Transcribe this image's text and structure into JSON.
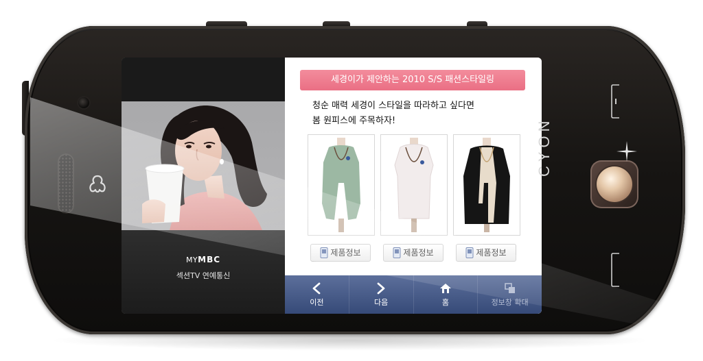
{
  "device": {
    "brand_text": "CYON"
  },
  "left_pane": {
    "caption_logo_prefix": "MY",
    "caption_logo_suffix": "MBC",
    "caption_subtitle": "섹션TV 연예통신"
  },
  "right_pane": {
    "headline": "세경이가 제안하는 2010 S/S 패션스타일링",
    "intro_line1": "청순 매력 세경이 스타일을 따라하고 싶다면",
    "intro_line2": "봄 원피스에 주목하자!",
    "products": [
      {
        "button_label": "제품정보",
        "color": "#9cb8a3"
      },
      {
        "button_label": "제품정보",
        "color": "#f2ecec"
      },
      {
        "button_label": "제품정보",
        "color": "#151515"
      }
    ]
  },
  "nav": {
    "prev_label": "이전",
    "next_label": "다음",
    "home_label": "홈",
    "expand_label": "정보창 확대"
  },
  "colors": {
    "banner": "#ea6f84",
    "nav_bar": "#364a78"
  },
  "icons": {
    "prev": "chevron-left-icon",
    "next": "chevron-right-icon",
    "home": "home-icon",
    "expand": "expand-icon",
    "info": "phone-icon"
  }
}
